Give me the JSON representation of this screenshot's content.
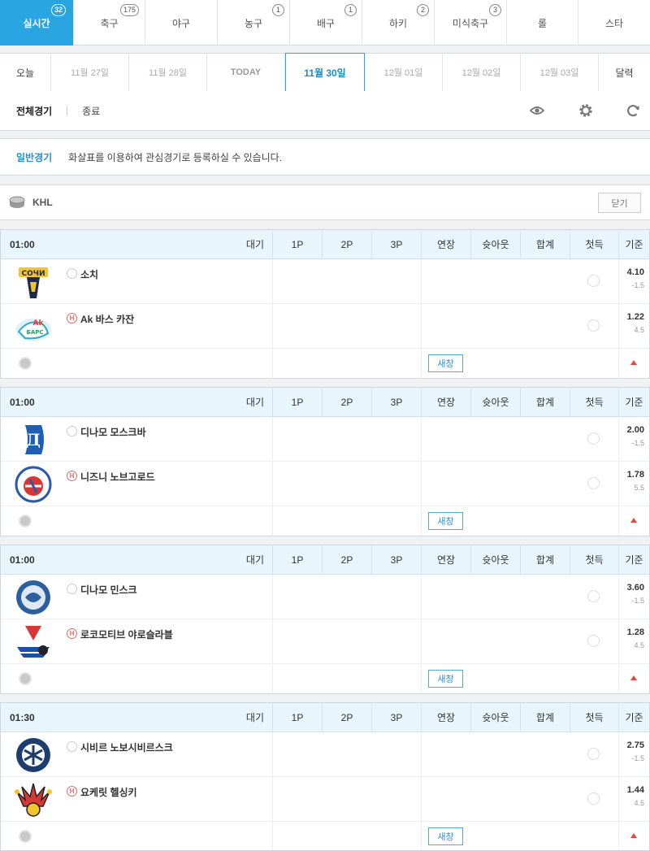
{
  "sport_tabs": [
    {
      "label": "실시간",
      "count": "32",
      "active": true
    },
    {
      "label": "축구",
      "count": "175"
    },
    {
      "label": "야구",
      "count": ""
    },
    {
      "label": "농구",
      "count": "1"
    },
    {
      "label": "배구",
      "count": "1"
    },
    {
      "label": "하키",
      "count": "2"
    },
    {
      "label": "미식축구",
      "count": "3"
    },
    {
      "label": "롤",
      "count": ""
    },
    {
      "label": "스타",
      "count": ""
    }
  ],
  "date_bar": {
    "today_link": "오늘",
    "dates": [
      "11월 27일",
      "11월 28일",
      "TODAY",
      "11월 30일",
      "12월 01일",
      "12월 02일",
      "12월 03일"
    ],
    "calendar": "달력"
  },
  "filter": {
    "all": "전체경기",
    "ended": "종료"
  },
  "notice": {
    "title": "일반경기",
    "text": "화살표를 이용하여 관심경기로 등록하실 수 있습니다."
  },
  "league": {
    "name": "KHL",
    "close_label": "닫기"
  },
  "columns": {
    "p1": "1P",
    "p2": "2P",
    "p3": "3P",
    "ot": "연장",
    "so": "슛아웃",
    "total": "합계",
    "first": "첫득",
    "base": "기준"
  },
  "home_mark": "H",
  "new_window_label": "새창",
  "matches": [
    {
      "time": "01:00",
      "status": "대기",
      "away": {
        "name": "소치",
        "odds": "4.10",
        "hcap": "-1.5"
      },
      "home": {
        "name": "Ak 바스 카잔",
        "odds": "1.22",
        "hcap": "4.5"
      }
    },
    {
      "time": "01:00",
      "status": "대기",
      "away": {
        "name": "디나모 모스크바",
        "odds": "2.00",
        "hcap": "-1.5"
      },
      "home": {
        "name": "니즈니 노브고로드",
        "odds": "1.78",
        "hcap": "5.5"
      }
    },
    {
      "time": "01:00",
      "status": "대기",
      "away": {
        "name": "디나모 민스크",
        "odds": "3.60",
        "hcap": "-1.5"
      },
      "home": {
        "name": "로코모티브 야로슬라블",
        "odds": "1.28",
        "hcap": "4.5"
      }
    },
    {
      "time": "01:30",
      "status": "대기",
      "away": {
        "name": "시비르 노보시비르스크",
        "odds": "2.75",
        "hcap": "-1.5"
      },
      "home": {
        "name": "요케릿 헬싱키",
        "odds": "1.44",
        "hcap": "4.5"
      }
    }
  ],
  "colors": {
    "accent": "#29a5e2",
    "header_bg": "#e9f5fc",
    "home_mark": "#e06b6b",
    "arrow": "#e24a3a"
  }
}
